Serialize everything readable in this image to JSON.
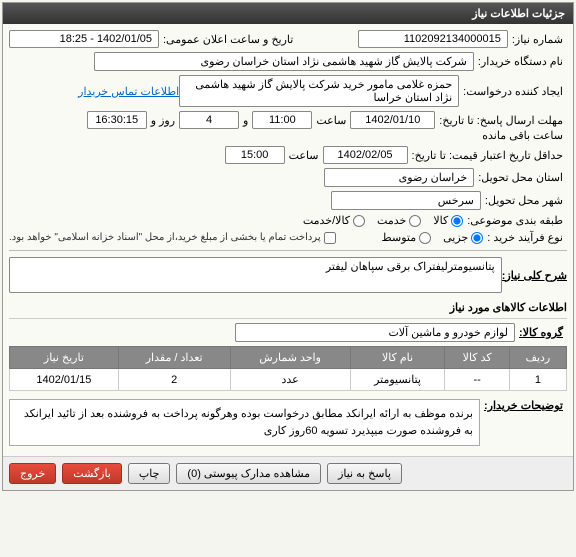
{
  "panel_title": "جزئیات اطلاعات نیاز",
  "labels": {
    "need_number": "شماره نیاز:",
    "announce_datetime": "تاریخ و ساعت اعلان عمومی:",
    "buyer_org": "نام دستگاه خریدار:",
    "creator": "ایجاد کننده درخواست:",
    "contact_link": "اطلاعات تماس خریدار",
    "deadline": "مهلت ارسال پاسخ: تا تاریخ:",
    "hour": "ساعت",
    "and": "و",
    "day": "روز و",
    "time_remaining": "ساعت باقی مانده",
    "validity_min": "حداقل تاریخ اعتبار قیمت: تا تاریخ:",
    "delivery_province": "استان محل تحویل:",
    "delivery_city": "شهر محل تحویل:",
    "category": "طبقه بندی موضوعی:",
    "cat_goods": "کالا",
    "cat_service": "خدمت",
    "cat_goods_service": "کالا/خدمت",
    "process_type": "نوع فرآیند خرید :",
    "proc_small": "جزیی",
    "proc_medium": "متوسط",
    "payment_note": "پرداخت تمام یا بخشی از مبلغ خرید،از محل \"اسناد خزانه اسلامی\" خواهد بود.",
    "need_desc": "شرح کلی نیاز:",
    "goods_info": "اطلاعات کالاهای مورد نیاز",
    "goods_group": "گروه کالا:",
    "buyer_notes": "توضیحات خریدار:"
  },
  "values": {
    "need_number": "1102092134000015",
    "announce_datetime": "1402/01/05 - 18:25",
    "buyer_org": "شرکت پالایش گاز شهید هاشمی نژاد   استان خراسان رضوی",
    "creator": "حمزه غلامی مامور خرید شرکت پالایش گاز شهید هاشمی نژاد   استان خراسا",
    "deadline_date": "1402/01/10",
    "deadline_time": "11:00",
    "deadline_days": "4",
    "deadline_remain": "16:30:15",
    "validity_date": "1402/02/05",
    "validity_time": "15:00",
    "delivery_province": "خراسان رضوی",
    "delivery_city": "سرخس",
    "need_desc": "پتانسیومترلیفتراک برقی سپاهان لیفتر",
    "goods_group": "لوازم خودرو و ماشین آلات",
    "buyer_notes": "برنده موظف به ارائه ایرانکد مطابق درخواست بوده وهرگونه پرداخت به فروشنده بعد از تائید ایرانکد به فروشنده صورت میپذیرد تسویه 60روز کاری"
  },
  "table": {
    "headers": {
      "row": "ردیف",
      "code": "کد کالا",
      "name": "نام کالا",
      "unit": "واحد شمارش",
      "qty": "تعداد / مقدار",
      "date": "تاریخ نیاز"
    },
    "rows": [
      {
        "row": "1",
        "code": "--",
        "name": "پتانسیومتر",
        "unit": "عدد",
        "qty": "2",
        "date": "1402/01/15"
      }
    ]
  },
  "buttons": {
    "respond": "پاسخ به نیاز",
    "attachments": "مشاهده مدارک پیوستی (0)",
    "print": "چاپ",
    "back": "بازگشت",
    "exit": "خروج"
  }
}
